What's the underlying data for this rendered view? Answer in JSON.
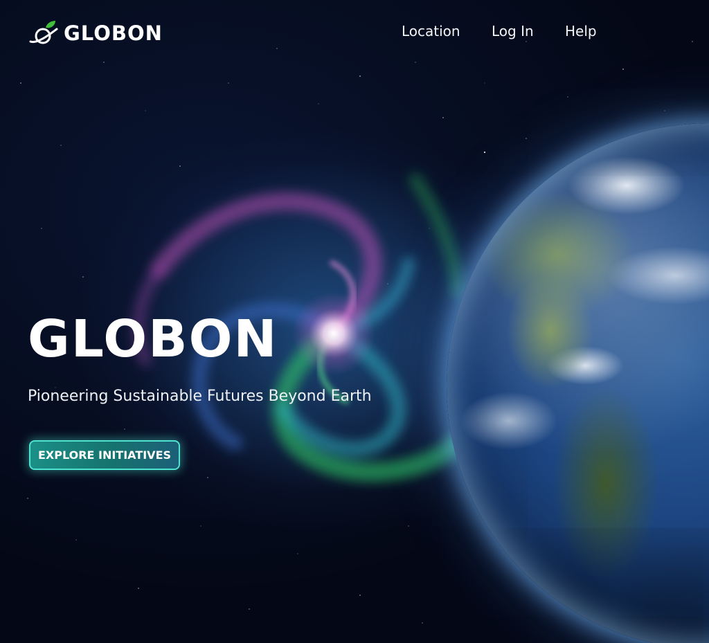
{
  "brand": {
    "name": "GLOBON",
    "logo_icon": "planet-leaf-icon",
    "accent_color": "#3fbf3a"
  },
  "nav": {
    "items": [
      {
        "label": "Location"
      },
      {
        "label": "Log In"
      },
      {
        "label": "Help"
      }
    ]
  },
  "hero": {
    "title": "GLOBON",
    "subtitle": "Pioneering Sustainable Futures Beyond Earth",
    "cta_label": "EXPLORE INITIATIVES",
    "cta_color": "#1a8f86"
  },
  "background": {
    "elements": [
      "galaxy",
      "earth",
      "stars"
    ]
  }
}
